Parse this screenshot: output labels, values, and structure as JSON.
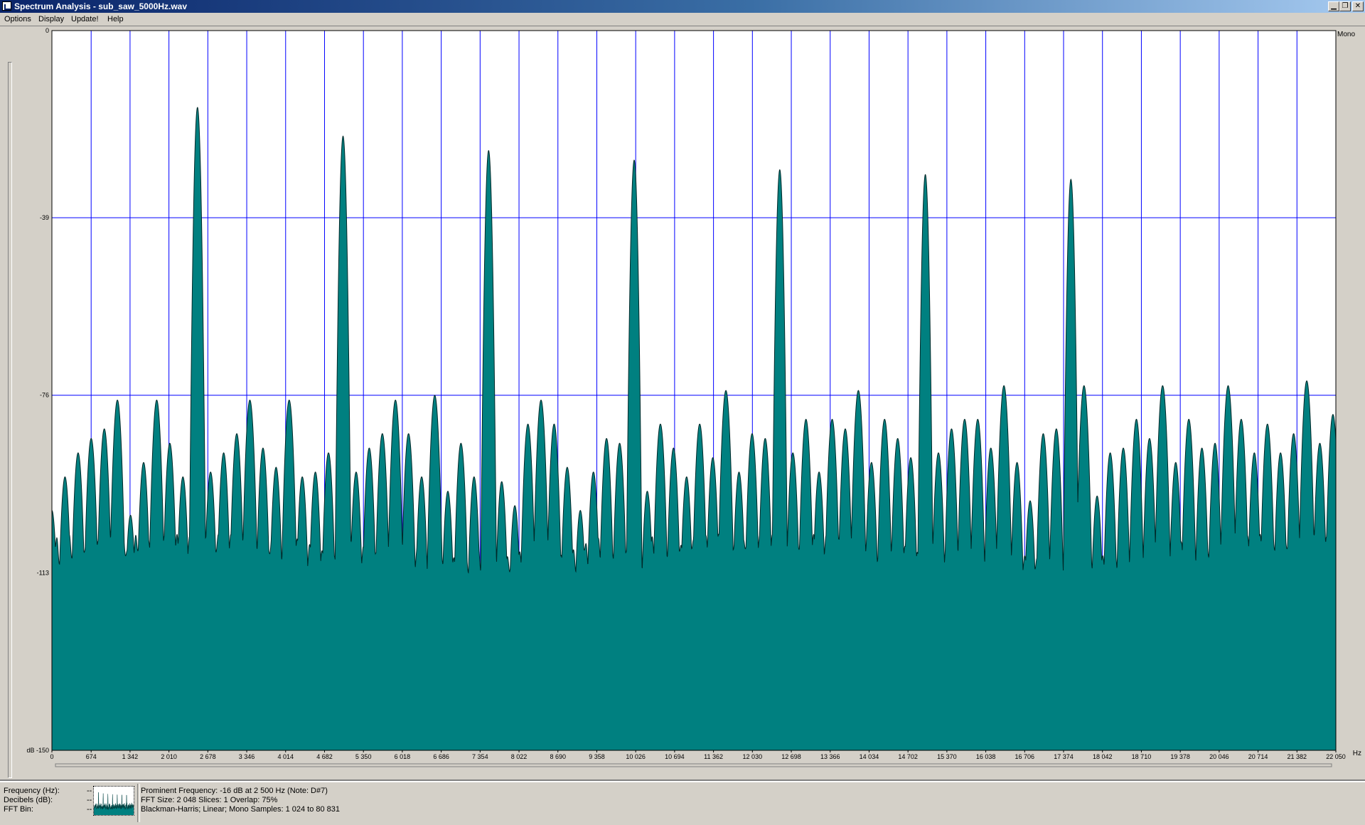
{
  "window": {
    "title": "Spectrum Analysis - sub_saw_5000Hz.wav",
    "minimize_glyph": "▁",
    "maximize_glyph": "❐",
    "close_glyph": "✕"
  },
  "menu": [
    "Options",
    "Display",
    "Update!",
    "Help"
  ],
  "chart_data": {
    "type": "area",
    "xlabel": "Hz",
    "ylabel": "dB",
    "channel_label": "Mono",
    "xlim": [
      0,
      22050
    ],
    "ylim": [
      -150,
      0
    ],
    "x_ticks": [
      0,
      674,
      1342,
      2010,
      2678,
      3346,
      4014,
      4682,
      5350,
      6018,
      6686,
      7354,
      8022,
      8690,
      9358,
      10026,
      10694,
      11362,
      12030,
      12698,
      13366,
      14034,
      14702,
      15370,
      16038,
      16706,
      17374,
      18042,
      18710,
      19378,
      20046,
      20714,
      21382,
      22050
    ],
    "x_tick_labels": [
      "0",
      "674",
      "1 342",
      "2 010",
      "2 678",
      "3 346",
      "4 014",
      "4 682",
      "5 350",
      "6 018",
      "6 686",
      "7 354",
      "8 022",
      "8 690",
      "9 358",
      "10 026",
      "10 694",
      "11 362",
      "12 030",
      "12 698",
      "13 366",
      "14 034",
      "14 702",
      "15 370",
      "16 038",
      "16 706",
      "17 374",
      "18 042",
      "18 710",
      "19 378",
      "20 046",
      "20 714",
      "21 382",
      "22 050"
    ],
    "y_ticks": [
      0,
      -39,
      -76,
      -113,
      -150
    ],
    "y_tick_labels": [
      "0",
      "-39",
      "-76",
      "-113",
      "dB -150"
    ],
    "grid": true,
    "noise_floor_db": -109,
    "fill_color": "#008080",
    "background_color": "#ffffff",
    "grid_color": "#0000ff",
    "major_peaks": [
      {
        "hz": 2500,
        "db": -16
      },
      {
        "hz": 5000,
        "db": -22
      },
      {
        "hz": 7500,
        "db": -25
      },
      {
        "hz": 10000,
        "db": -27
      },
      {
        "hz": 12500,
        "db": -29
      },
      {
        "hz": 15000,
        "db": -30
      },
      {
        "hz": 17500,
        "db": -31
      }
    ],
    "minor_peaks": [
      {
        "hz": 0,
        "db": -100
      },
      {
        "hz": 225,
        "db": -93
      },
      {
        "hz": 450,
        "db": -88
      },
      {
        "hz": 675,
        "db": -85
      },
      {
        "hz": 900,
        "db": -83
      },
      {
        "hz": 1125,
        "db": -77
      },
      {
        "hz": 1350,
        "db": -101
      },
      {
        "hz": 1575,
        "db": -90
      },
      {
        "hz": 1800,
        "db": -77
      },
      {
        "hz": 2025,
        "db": -86
      },
      {
        "hz": 2250,
        "db": -93
      },
      {
        "hz": 2725,
        "db": -92
      },
      {
        "hz": 2950,
        "db": -88
      },
      {
        "hz": 3175,
        "db": -84
      },
      {
        "hz": 3400,
        "db": -77
      },
      {
        "hz": 3625,
        "db": -87
      },
      {
        "hz": 3850,
        "db": -91
      },
      {
        "hz": 4075,
        "db": -77
      },
      {
        "hz": 4300,
        "db": -93
      },
      {
        "hz": 4525,
        "db": -92
      },
      {
        "hz": 4750,
        "db": -88
      },
      {
        "hz": 5225,
        "db": -92
      },
      {
        "hz": 5450,
        "db": -87
      },
      {
        "hz": 5675,
        "db": -84
      },
      {
        "hz": 5900,
        "db": -77
      },
      {
        "hz": 6125,
        "db": -84
      },
      {
        "hz": 6350,
        "db": -93
      },
      {
        "hz": 6575,
        "db": -76
      },
      {
        "hz": 6800,
        "db": -96
      },
      {
        "hz": 7025,
        "db": -86
      },
      {
        "hz": 7250,
        "db": -93
      },
      {
        "hz": 7725,
        "db": -94
      },
      {
        "hz": 7950,
        "db": -99
      },
      {
        "hz": 8175,
        "db": -82
      },
      {
        "hz": 8400,
        "db": -77
      },
      {
        "hz": 8625,
        "db": -82
      },
      {
        "hz": 8850,
        "db": -91
      },
      {
        "hz": 9075,
        "db": -100
      },
      {
        "hz": 9300,
        "db": -92
      },
      {
        "hz": 9525,
        "db": -85
      },
      {
        "hz": 9750,
        "db": -86
      },
      {
        "hz": 10225,
        "db": -96
      },
      {
        "hz": 10450,
        "db": -82
      },
      {
        "hz": 10675,
        "db": -87
      },
      {
        "hz": 10900,
        "db": -93
      },
      {
        "hz": 11125,
        "db": -82
      },
      {
        "hz": 11350,
        "db": -89
      },
      {
        "hz": 11575,
        "db": -75
      },
      {
        "hz": 11800,
        "db": -92
      },
      {
        "hz": 12025,
        "db": -84
      },
      {
        "hz": 12250,
        "db": -85
      },
      {
        "hz": 12725,
        "db": -88
      },
      {
        "hz": 12950,
        "db": -81
      },
      {
        "hz": 13175,
        "db": -92
      },
      {
        "hz": 13400,
        "db": -81
      },
      {
        "hz": 13625,
        "db": -83
      },
      {
        "hz": 13850,
        "db": -75
      },
      {
        "hz": 14075,
        "db": -90
      },
      {
        "hz": 14300,
        "db": -81
      },
      {
        "hz": 14525,
        "db": -85
      },
      {
        "hz": 14750,
        "db": -89
      },
      {
        "hz": 15225,
        "db": -88
      },
      {
        "hz": 15450,
        "db": -83
      },
      {
        "hz": 15675,
        "db": -81
      },
      {
        "hz": 15900,
        "db": -81
      },
      {
        "hz": 16125,
        "db": -87
      },
      {
        "hz": 16350,
        "db": -74
      },
      {
        "hz": 16575,
        "db": -90
      },
      {
        "hz": 16800,
        "db": -98
      },
      {
        "hz": 17025,
        "db": -84
      },
      {
        "hz": 17250,
        "db": -83
      },
      {
        "hz": 17725,
        "db": -74
      },
      {
        "hz": 17950,
        "db": -97
      },
      {
        "hz": 18175,
        "db": -88
      },
      {
        "hz": 18400,
        "db": -87
      },
      {
        "hz": 18625,
        "db": -81
      },
      {
        "hz": 18850,
        "db": -85
      },
      {
        "hz": 19075,
        "db": -74
      },
      {
        "hz": 19300,
        "db": -90
      },
      {
        "hz": 19525,
        "db": -81
      },
      {
        "hz": 19750,
        "db": -87
      },
      {
        "hz": 19975,
        "db": -86
      },
      {
        "hz": 20200,
        "db": -74
      },
      {
        "hz": 20425,
        "db": -81
      },
      {
        "hz": 20650,
        "db": -88
      },
      {
        "hz": 20875,
        "db": -82
      },
      {
        "hz": 21100,
        "db": -88
      },
      {
        "hz": 21325,
        "db": -84
      },
      {
        "hz": 21550,
        "db": -73
      },
      {
        "hz": 21775,
        "db": -86
      },
      {
        "hz": 22000,
        "db": -80
      }
    ]
  },
  "status": {
    "labels": [
      "Frequency (Hz):",
      "Decibels (dB):",
      "FFT Bin:"
    ],
    "values": [
      "--",
      "--",
      "--"
    ],
    "line1": "Prominent Frequency: -16 dB at 2 500 Hz (Note: D#7)",
    "line2": "FFT Size: 2 048  Slices: 1  Overlap: 75%",
    "line3": "Blackman-Harris; Linear; Mono  Samples: 1 024 to 80 831"
  }
}
